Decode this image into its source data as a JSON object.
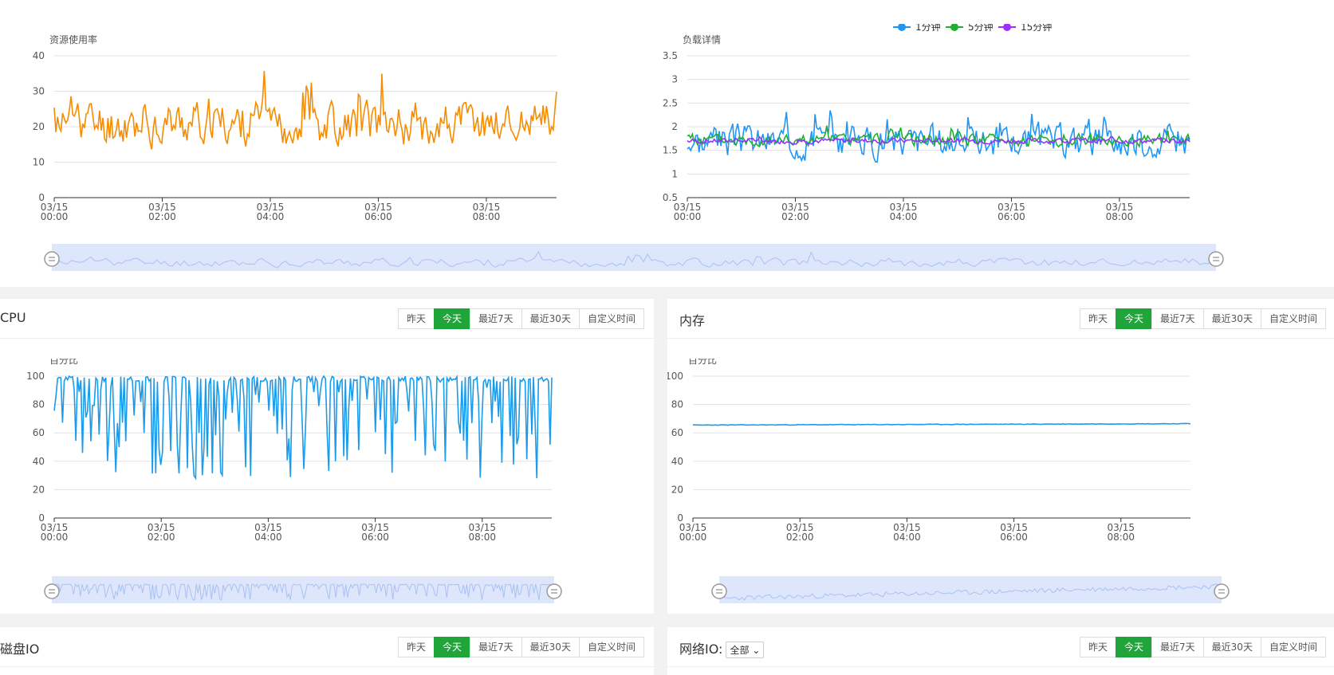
{
  "resource_chart": {
    "title": "资源使用率",
    "chart_data": {
      "type": "line",
      "title": "资源使用率",
      "xlabel": "",
      "ylabel": "",
      "ylim": [
        0,
        40
      ],
      "yticks": [
        0,
        10,
        20,
        30,
        40
      ],
      "x_ticks": [
        [
          "03/15",
          "00:00"
        ],
        [
          "03/15",
          "02:00"
        ],
        [
          "03/15",
          "04:00"
        ],
        [
          "03/15",
          "06:00"
        ],
        [
          "03/15",
          "08:00"
        ]
      ],
      "x_range": [
        0,
        9.3
      ],
      "grid": true,
      "series": [
        {
          "color": "#f78c00",
          "base": 21,
          "amp": 9,
          "min": 6,
          "max": 40,
          "points": 300,
          "seed": 11
        }
      ]
    }
  },
  "load_chart": {
    "title": "负载详情",
    "legend": [
      "1分钟",
      "5分钟",
      "15分钟"
    ],
    "chart_data": {
      "type": "line",
      "title": "负载详情",
      "xlabel": "",
      "ylabel": "",
      "ylim": [
        0.5,
        3.5
      ],
      "yticks": [
        0.5,
        1,
        1.5,
        2,
        2.5,
        3,
        3.5
      ],
      "x_ticks": [
        [
          "03/15",
          "00:00"
        ],
        [
          "03/15",
          "02:00"
        ],
        [
          "03/15",
          "04:00"
        ],
        [
          "03/15",
          "06:00"
        ],
        [
          "03/15",
          "08:00"
        ]
      ],
      "x_range": [
        0,
        9.3
      ],
      "grid": true,
      "legend_position": "top-right",
      "series": [
        {
          "name": "1分钟",
          "color": "#2196f3",
          "base": 1.7,
          "amp": 0.5,
          "min": 0.55,
          "max": 3.15,
          "points": 300,
          "seed": 3
        },
        {
          "name": "5分钟",
          "color": "#20b030",
          "base": 1.72,
          "amp": 0.18,
          "min": 1.2,
          "max": 2.4,
          "points": 300,
          "seed": 5
        },
        {
          "name": "15分钟",
          "color": "#9b30ff",
          "base": 1.7,
          "amp": 0.08,
          "min": 1.3,
          "max": 2.1,
          "points": 300,
          "seed": 7
        }
      ]
    }
  },
  "cpu_card": {
    "title": "CPU",
    "buttons": [
      "昨天",
      "今天",
      "最近7天",
      "最近30天",
      "自定义时间"
    ],
    "active_index": 1,
    "chart_data": {
      "type": "line",
      "title": "",
      "xlabel": "",
      "ylabel": "百分比",
      "ylim": [
        0,
        100
      ],
      "yticks": [
        0,
        20,
        40,
        60,
        80,
        100
      ],
      "x_ticks": [
        [
          "03/15",
          "00:00"
        ],
        [
          "03/15",
          "02:00"
        ],
        [
          "03/15",
          "04:00"
        ],
        [
          "03/15",
          "06:00"
        ],
        [
          "03/15",
          "08:00"
        ]
      ],
      "x_range": [
        0,
        9.3
      ],
      "grid": true,
      "series": [
        {
          "color": "#1a9bec",
          "base": 70,
          "amp": 40,
          "min": 28,
          "max": 100,
          "points": 300,
          "seed": 19
        }
      ]
    }
  },
  "memory_card": {
    "title": "内存",
    "buttons": [
      "昨天",
      "今天",
      "最近7天",
      "最近30天",
      "自定义时间"
    ],
    "active_index": 1,
    "chart_data": {
      "type": "line",
      "title": "",
      "xlabel": "",
      "ylabel": "百分比",
      "ylim": [
        0,
        100
      ],
      "yticks": [
        0,
        20,
        40,
        60,
        80,
        100
      ],
      "x_ticks": [
        [
          "03/15",
          "00:00"
        ],
        [
          "03/15",
          "02:00"
        ],
        [
          "03/15",
          "04:00"
        ],
        [
          "03/15",
          "06:00"
        ],
        [
          "03/15",
          "08:00"
        ]
      ],
      "x_range": [
        0,
        9.3
      ],
      "grid": true,
      "series": [
        {
          "color": "#1a9bec",
          "flat": [
            65.5,
            66.5
          ],
          "points": 200,
          "seed": 23
        }
      ]
    }
  },
  "disk_card": {
    "title": "磁盘IO",
    "buttons": [
      "昨天",
      "今天",
      "最近7天",
      "最近30天",
      "自定义时间"
    ],
    "active_index": 1
  },
  "network_card": {
    "title": "网络IO:",
    "select_value": "全部",
    "buttons": [
      "昨天",
      "今天",
      "最近7天",
      "最近30天",
      "自定义时间"
    ],
    "active_index": 1
  },
  "colors": {
    "accent": "#20a53a",
    "slider_fill": "#dde6fb",
    "slider_line": "#aac1f2"
  }
}
